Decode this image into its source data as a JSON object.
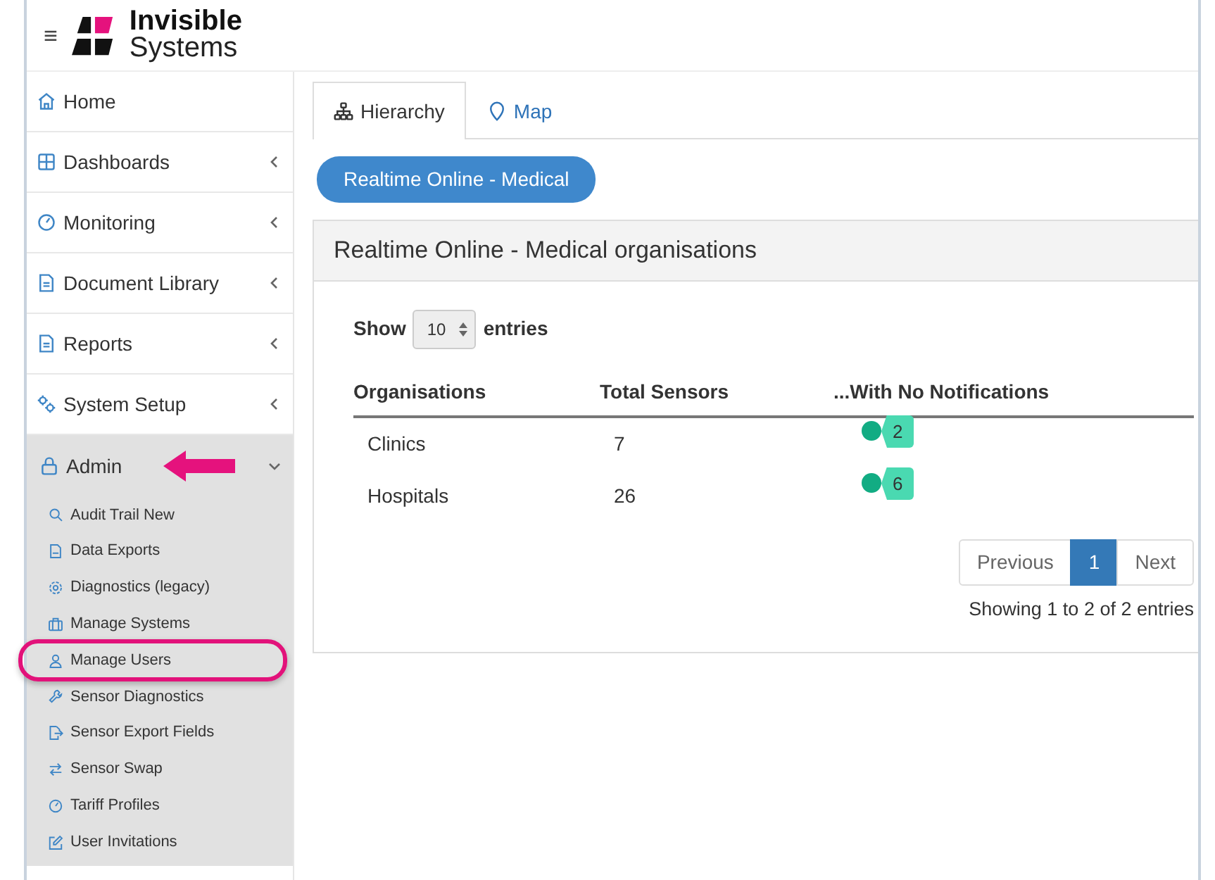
{
  "header": {
    "menu_glyph": "≡",
    "logo": {
      "line_1": "Invisible",
      "line_2": "Systems"
    }
  },
  "sidebar": {
    "items": [
      {
        "label": "Home",
        "kind": "link"
      },
      {
        "label": "Dashboards",
        "kind": "group",
        "expanded": false
      },
      {
        "label": "Monitoring",
        "kind": "group",
        "expanded": false
      },
      {
        "label": "Document Library",
        "kind": "group",
        "expanded": false
      },
      {
        "label": "Reports",
        "kind": "group",
        "expanded": false
      },
      {
        "label": "System Setup",
        "kind": "group",
        "expanded": false
      },
      {
        "label": "Admin",
        "kind": "group",
        "expanded": true,
        "pointed_at": true,
        "children": [
          {
            "label": "Audit Trail New",
            "circled": false
          },
          {
            "label": "Data Exports",
            "circled": false
          },
          {
            "label": "Diagnostics (legacy)",
            "circled": false
          },
          {
            "label": "Manage Systems",
            "circled": false
          },
          {
            "label": "Manage Users",
            "circled": true
          },
          {
            "label": "Sensor Diagnostics",
            "circled": false
          },
          {
            "label": "Sensor Export Fields",
            "circled": false
          },
          {
            "label": "Sensor Swap",
            "circled": false
          },
          {
            "label": "Tariff Profiles",
            "circled": false
          },
          {
            "label": "User Invitations",
            "circled": false
          }
        ]
      }
    ]
  },
  "tabs": [
    {
      "label": "Hierarchy",
      "selected": true
    },
    {
      "label": "Map",
      "selected": false
    }
  ],
  "breadcrumb_button": "Realtime Online - Medical",
  "card": {
    "title": "Realtime Online - Medical organisations",
    "length": {
      "before": "Show",
      "value": "10",
      "after": "entries"
    },
    "table": {
      "columns": [
        "Organisations",
        "Total Sensors",
        "...With No Notifications"
      ],
      "rows": [
        {
          "organisation": "Clinics",
          "total": "7",
          "no_notifications": "2"
        },
        {
          "organisation": "Hospitals",
          "total": "26",
          "no_notifications": "6"
        }
      ]
    },
    "pagination": [
      {
        "label": "Previous",
        "selected": false
      },
      {
        "label": "1",
        "selected": true
      },
      {
        "label": "Next",
        "selected": false
      }
    ],
    "info": "Showing 1 to 2 of 2 entries"
  }
}
